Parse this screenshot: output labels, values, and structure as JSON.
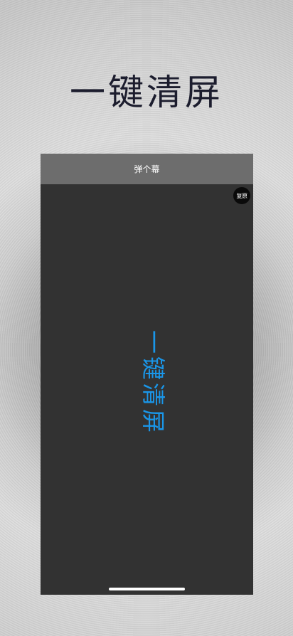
{
  "hero": {
    "title": "一键清屏"
  },
  "screen": {
    "header_title": "弹个幕",
    "restore_button": "复原",
    "danmaku_text": "一键清屏"
  },
  "colors": {
    "hero_text": "#1c1d2e",
    "screen_bg": "#323232",
    "header_bg": "#6d6d6d",
    "danmaku_text": "#1a96e8",
    "restore_bg": "#0a0a0a"
  }
}
